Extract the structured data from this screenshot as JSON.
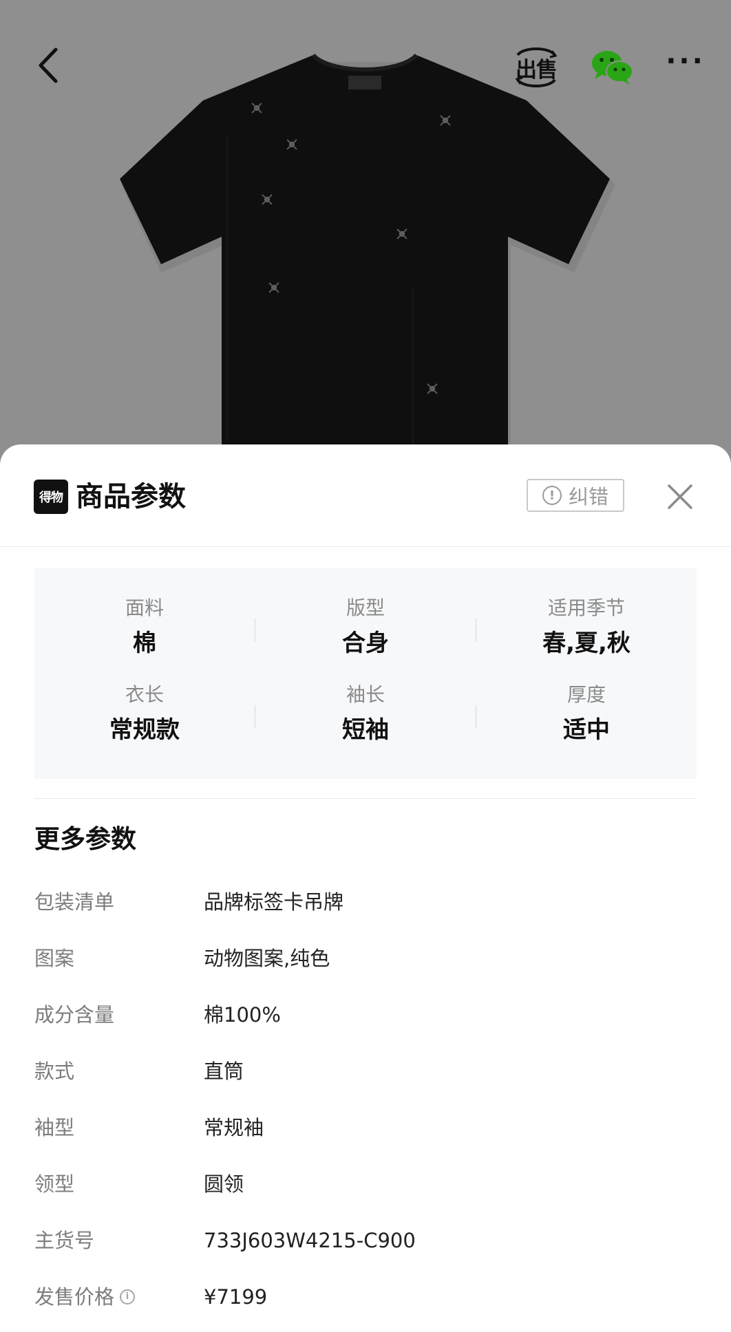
{
  "topbar": {
    "sell_label": "出售",
    "more_label": "···"
  },
  "sheet": {
    "logo_text": "得物",
    "title": "商品参数",
    "report_label": "纠错",
    "report_icon_glyph": "!"
  },
  "key_params": [
    {
      "label": "面料",
      "value": "棉"
    },
    {
      "label": "版型",
      "value": "合身"
    },
    {
      "label": "适用季节",
      "value": "春,夏,秋"
    },
    {
      "label": "衣长",
      "value": "常规款"
    },
    {
      "label": "袖长",
      "value": "短袖"
    },
    {
      "label": "厚度",
      "value": "适中"
    }
  ],
  "more_params": {
    "title": "更多参数",
    "rows": [
      {
        "key": "包装清单",
        "value": "品牌标签卡吊牌"
      },
      {
        "key": "图案",
        "value": "动物图案,纯色"
      },
      {
        "key": "成分含量",
        "value": "棉100%"
      },
      {
        "key": "款式",
        "value": "直筒"
      },
      {
        "key": "袖型",
        "value": "常规袖"
      },
      {
        "key": "领型",
        "value": "圆领"
      },
      {
        "key": "主货号",
        "value": "733J603W4215-C900"
      },
      {
        "key": "发售价格",
        "value": "¥7199"
      }
    ],
    "price_info_glyph": "i"
  },
  "colors": {
    "hero_bg": "#8f8f8f",
    "sheet_bg": "#ffffff",
    "params_bg": "#f7f8fa",
    "wechat_green": "#2aa515"
  }
}
